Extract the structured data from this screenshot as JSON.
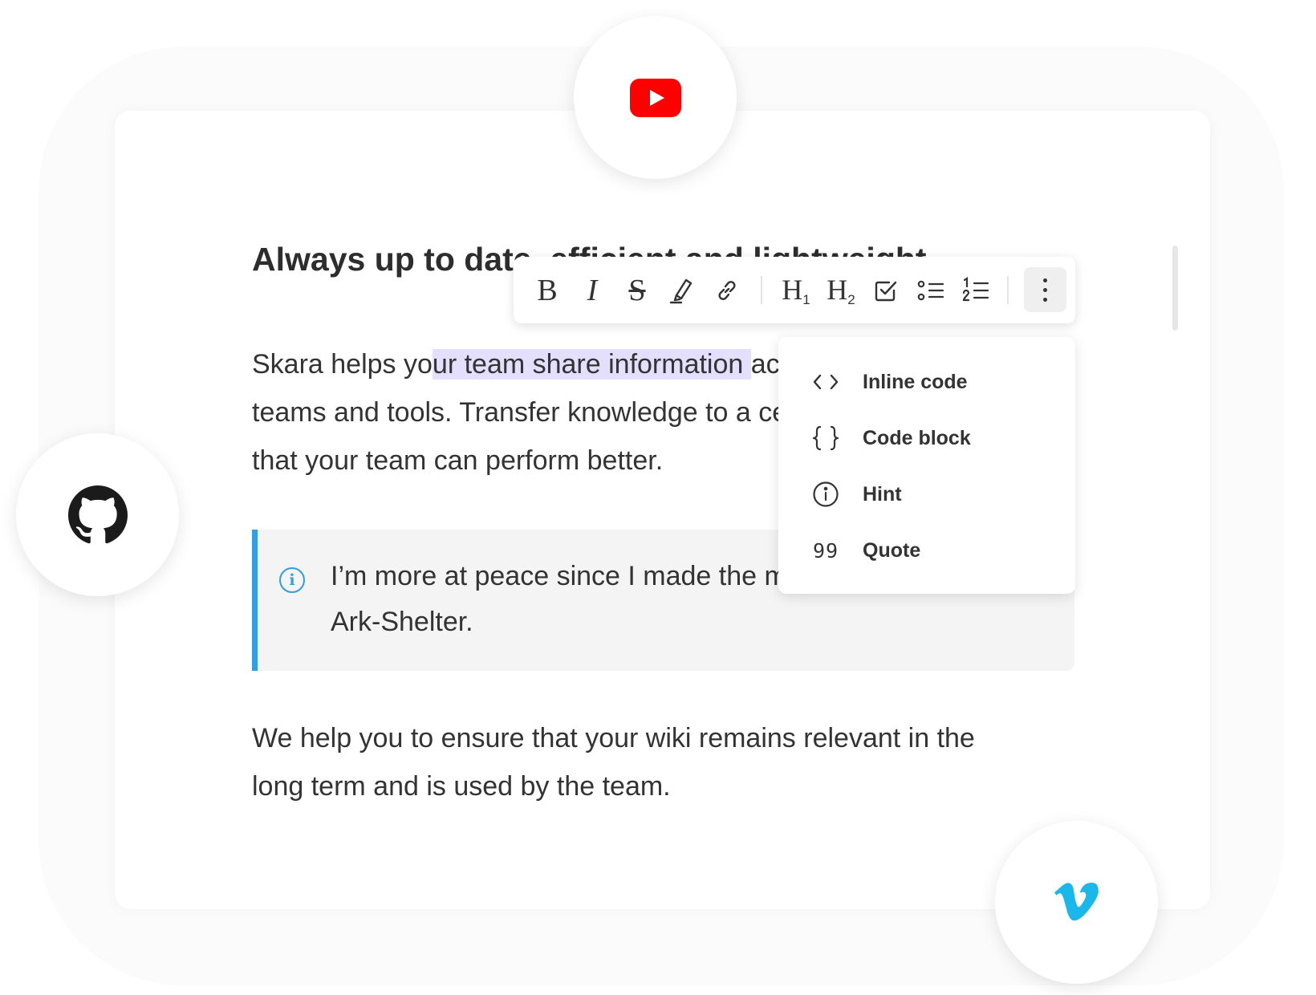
{
  "heading": "Always up to date, efficient and lightweight",
  "paragraph1": {
    "before": "Skara helps yo",
    "highlight": "ur team share information ",
    "after": "across",
    "line2": "teams and tools. Transfer knowledge to a central place so",
    "line3": "that your team can perform better."
  },
  "hint": {
    "line1": "I’m more at peace since I made the move to the",
    "line2": "Ark-Shelter."
  },
  "paragraph2": {
    "line1": "We help you to ensure that your wiki remains relevant in the",
    "line2": "long term and is used by the team."
  },
  "toolbar": {
    "bold": "B",
    "italic": "I",
    "strike": "S",
    "h1": "H",
    "h1_sub": "1",
    "h2": "H",
    "h2_sub": "2"
  },
  "menu": {
    "items": [
      {
        "icon": "<>",
        "icon_name": "inline-code-icon",
        "label": "Inline code"
      },
      {
        "icon": "{}",
        "icon_name": "code-block-icon",
        "label": "Code block"
      },
      {
        "icon": "i",
        "icon_name": "info-icon",
        "label": "Hint"
      },
      {
        "icon": "99",
        "icon_name": "quote-icon",
        "label": "Quote"
      }
    ]
  },
  "colors": {
    "accent_blue": "#2f9fe0",
    "highlight": "#e4deff",
    "youtube_red": "#ff0000",
    "vimeo_blue": "#1ab7ea",
    "github_black": "#1b1b1b"
  },
  "icons": [
    "youtube-icon",
    "github-icon",
    "vimeo-icon"
  ]
}
